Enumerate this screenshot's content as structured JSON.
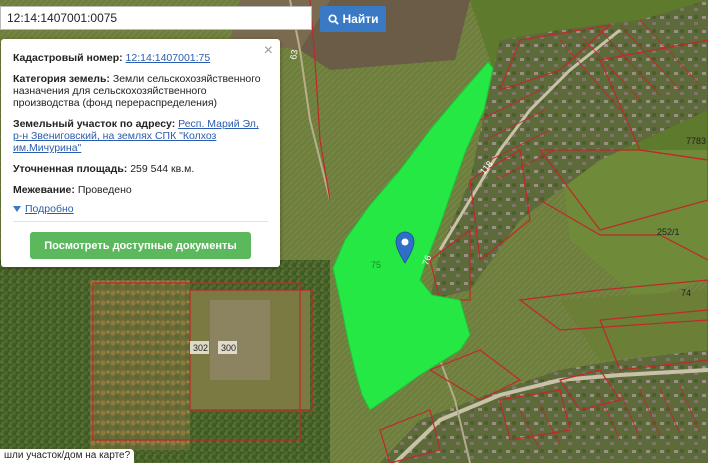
{
  "search": {
    "value": "12:14:1407001:0075",
    "button_label": "Найти"
  },
  "panel": {
    "cadastral_label": "Кадастровый номер:",
    "cadastral_value": "12:14:1407001:75",
    "category_label": "Категория земель:",
    "category_value": "Земли сельскохозяйственного назначения для сельскохозяйственного производства (фонд перераспределения)",
    "address_label": "Земельный участок по адресу:",
    "address_value": "Респ. Марий Эл, р-н Звениговский, на землях СПК \"Колхоз им.Мичурина\"",
    "area_label": "Уточненная площадь:",
    "area_value": "259 544 кв.м.",
    "survey_label": "Межевание:",
    "survey_value": "Проведено",
    "more_label": "Подробно",
    "docs_button": "Посмотреть доступные документы",
    "close_symbol": "×"
  },
  "map_labels": {
    "road_63": "63",
    "plot_118": "118",
    "plot_7783": "7783",
    "plot_252": "252/1",
    "plot_74": "74",
    "plot_75": "75",
    "plot_76": "76",
    "plot_302": "302",
    "plot_300": "300"
  },
  "bottom_tip": "шли участок/дом на карте?",
  "colors": {
    "highlight": "#22ee44",
    "parcel_border": "#c0282a",
    "button_blue": "#3a79c4",
    "button_green": "#5cb85c",
    "marker": "#2f6fc7"
  },
  "icons": [
    "search-icon",
    "close-icon",
    "triangle-down-icon",
    "map-marker-icon"
  ]
}
